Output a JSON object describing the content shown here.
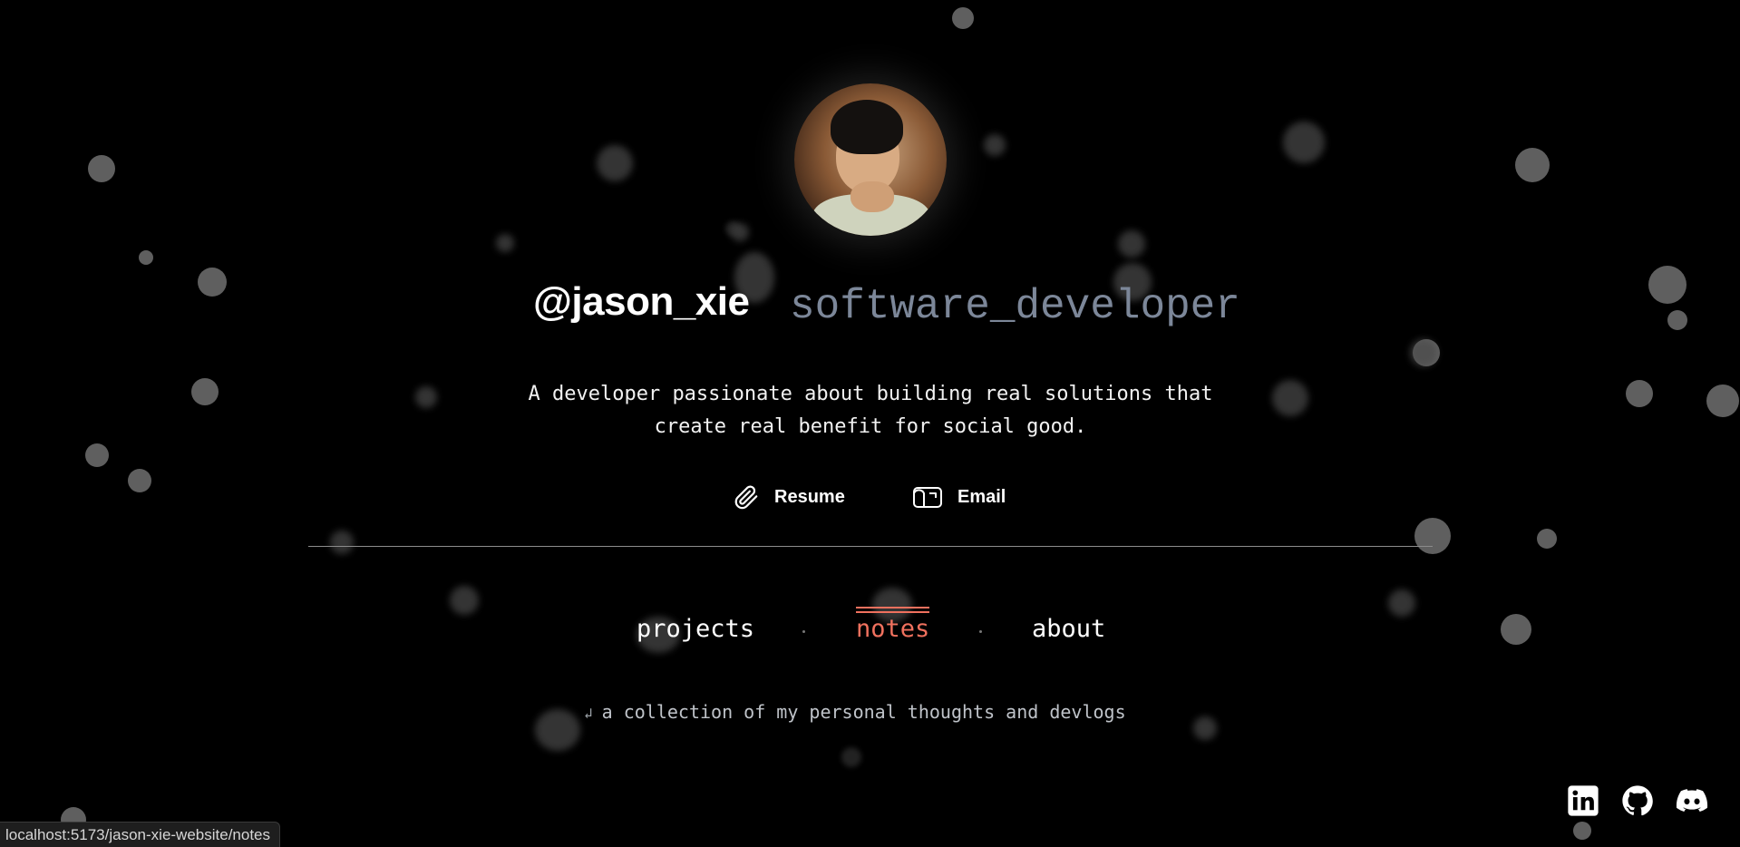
{
  "profile": {
    "handle": "@jason_xie",
    "role": "software_developer",
    "tagline": "A developer passionate about building real solutions that\ncreate real benefit for social good.",
    "avatar_alt": "avatar"
  },
  "links": {
    "resume_label": "Resume",
    "resume_icon": "paperclip-icon",
    "email_label": "Email",
    "email_icon": "mailbox-icon"
  },
  "tabs": [
    {
      "label": "projects",
      "active": false
    },
    {
      "label": "notes",
      "active": true
    },
    {
      "label": "about",
      "active": false
    }
  ],
  "caption": {
    "arrow": "↲",
    "text": "a collection of my personal thoughts and devlogs"
  },
  "social": {
    "icons": [
      "linkedin-icon",
      "github-icon",
      "discord-icon"
    ]
  },
  "status_bar": {
    "url": "localhost:5173/jason-xie-website/notes"
  },
  "colors": {
    "background": "#000000",
    "accent": "#f0715e",
    "role_text": "#7c8799",
    "caption_text": "#bfc3c9"
  }
}
